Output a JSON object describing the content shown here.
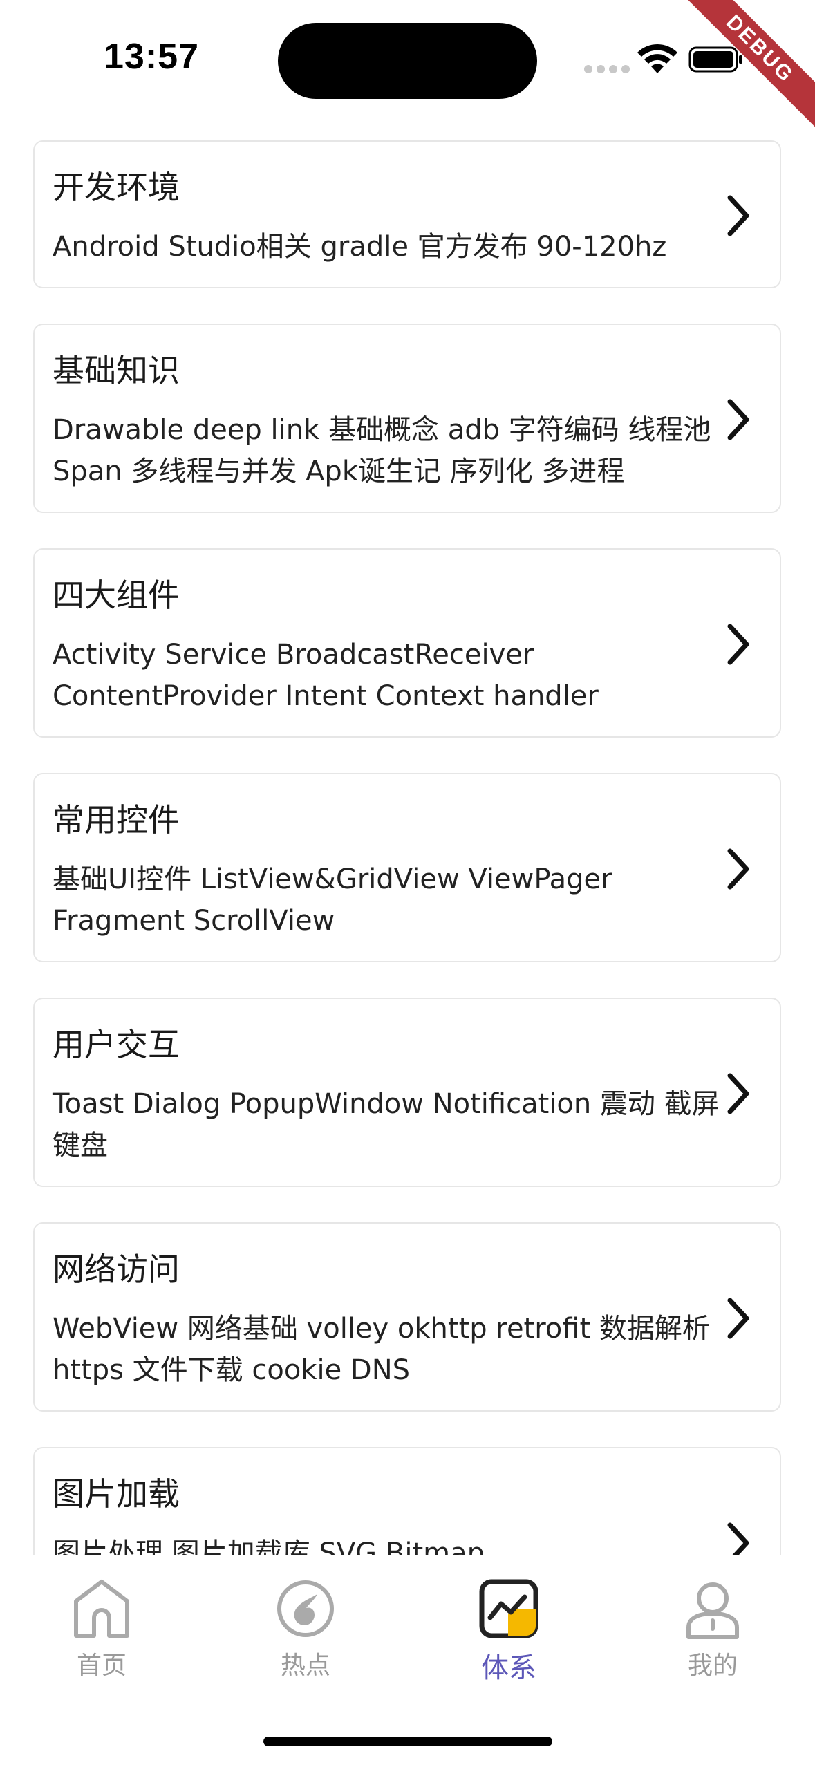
{
  "status_bar": {
    "time": "13:57"
  },
  "debug_banner": "DEBUG",
  "categories": [
    {
      "title": "开发环境",
      "desc": "Android Studio相关 gradle 官方发布 90-120hz"
    },
    {
      "title": "基础知识",
      "desc": "Drawable deep link 基础概念 adb 字符编码 线程池 Span 多线程与并发 Apk诞生记 序列化 多进程"
    },
    {
      "title": "四大组件",
      "desc": "Activity Service BroadcastReceiver ContentProvider Intent Context handler"
    },
    {
      "title": "常用控件",
      "desc": "基础UI控件 ListView&GridView ViewPager Fragment ScrollView"
    },
    {
      "title": "用户交互",
      "desc": "Toast Dialog PopupWindow Notification 震动 截屏 键盘"
    },
    {
      "title": "网络访问",
      "desc": "WebView 网络基础 volley okhttp retrofit 数据解析 https 文件下载 cookie DNS"
    },
    {
      "title": "图片加载",
      "desc": "图片处理 图片加载库 SVG Bitmap"
    }
  ],
  "tabbar": {
    "tabs": [
      {
        "label": "首页",
        "icon": "home-icon"
      },
      {
        "label": "热点",
        "icon": "hot-icon"
      },
      {
        "label": "体系",
        "icon": "system-chart-icon",
        "active": true
      },
      {
        "label": "我的",
        "icon": "profile-icon"
      }
    ]
  },
  "colors": {
    "active_tab": "#5c57b8",
    "inactive_tab": "#9a9a9a",
    "accent_yellow": "#f5b800",
    "card_border": "#e6e6e6",
    "debug_ribbon": "#b5343a"
  }
}
